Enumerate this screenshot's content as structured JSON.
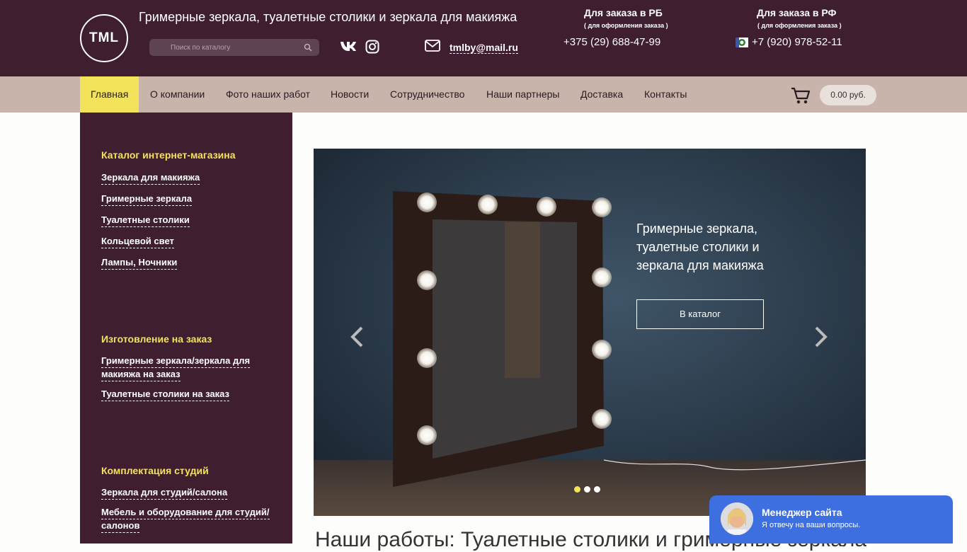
{
  "header": {
    "logo_text": "TML",
    "tagline": "Гримерные зеркала, туалетные столики и зеркала для макияжа",
    "search_placeholder": "Поиск по каталогу",
    "email": "tmlby@mail.ru",
    "contacts": [
      {
        "title": "Для заказа в РБ",
        "sub": "( для оформления заказа )",
        "phone": "+375 (29) 688-47-99"
      },
      {
        "title": "Для заказа в РФ",
        "sub": "( для оформления заказа )",
        "phone": "+7 (920) 978-52-11"
      }
    ],
    "icons": [
      "vk-icon",
      "instagram-icon",
      "mail-icon",
      "search-icon",
      "viber-icon"
    ]
  },
  "nav": {
    "items": [
      {
        "label": "Главная",
        "active": true
      },
      {
        "label": "О компании"
      },
      {
        "label": "Фото наших работ"
      },
      {
        "label": "Новости"
      },
      {
        "label": "Сотрудничество"
      },
      {
        "label": "Наши партнеры"
      },
      {
        "label": "Доставка"
      },
      {
        "label": "Контакты"
      }
    ],
    "cart_total": "0.00 руб."
  },
  "sidebar": {
    "sections": [
      {
        "title": "Каталог интернет-магазина",
        "links": [
          "Зеркала для макияжа",
          "Гримерные зеркала",
          "Туалетные столики",
          "Кольцевой свет",
          "Лампы, Ночники"
        ]
      },
      {
        "title": "Изготовление на заказ",
        "links": [
          "Гримерные зеркала/зеркала для",
          "макияжа на заказ",
          "Туалетные столики на заказ"
        ]
      },
      {
        "title": "Комплектация студий",
        "links": [
          "Зеркала для студий/салона",
          "Мебель и оборудование для студий/",
          "салонов"
        ]
      }
    ]
  },
  "slider": {
    "caption": "Гримерные зеркала, туалетные столики и зеркала для макияжа",
    "button": "В каталог",
    "dots": 3,
    "active_dot": 1
  },
  "main": {
    "heading": "Наши работы: Туалетные столики и гримерные зеркала"
  },
  "chat": {
    "name": "Менеджер сайта",
    "sub": "Я отвечу на ваши вопросы."
  },
  "colors": {
    "header_bg": "#3f1f2f",
    "nav_bg": "#c8b4ab",
    "accent": "#f3e35a",
    "chat_bg": "#3d6fe0"
  }
}
